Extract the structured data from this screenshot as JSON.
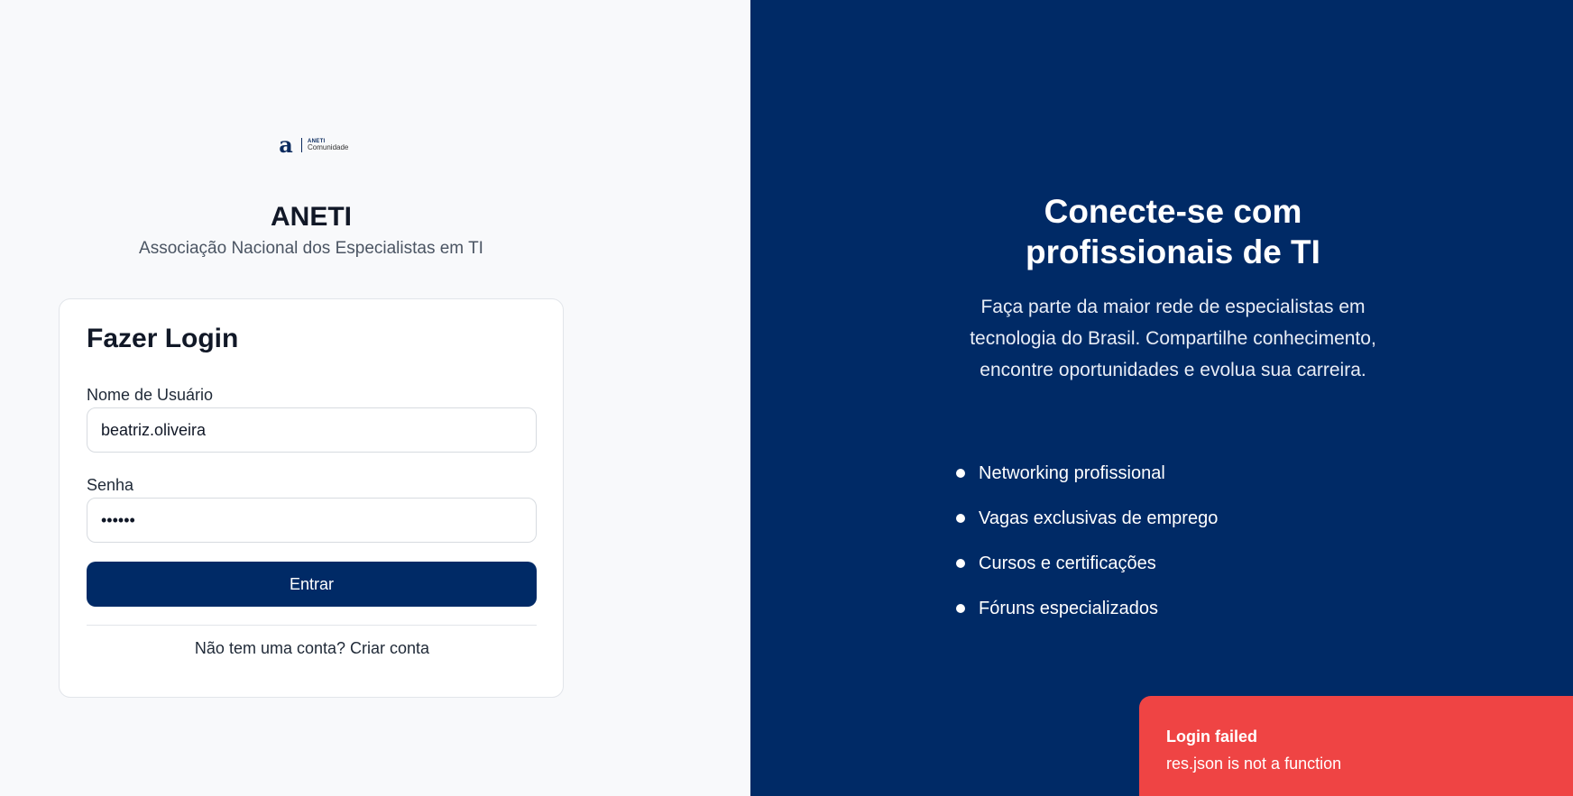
{
  "brand": {
    "logo_letter": "a",
    "logo_name": "ANETI",
    "logo_sub": "Comunidade",
    "title": "ANETI",
    "subtitle": "Associação Nacional dos Especialistas em TI"
  },
  "login": {
    "title": "Fazer Login",
    "username_label": "Nome de Usuário",
    "username_value": "beatriz.oliveira",
    "password_label": "Senha",
    "password_value": "••••••",
    "submit_label": "Entrar",
    "signup_prompt": "Não tem uma conta?",
    "signup_link": "Criar conta"
  },
  "hero": {
    "title_line1": "Conecte-se com",
    "title_line2": "profissionais de TI",
    "description": "Faça parte da maior rede de especialistas em tecnologia do Brasil. Compartilhe conhecimento, encontre oportunidades e evolua sua carreira.",
    "features": [
      "Networking profissional",
      "Vagas exclusivas de emprego",
      "Cursos e certificações",
      "Fóruns especializados"
    ]
  },
  "toast": {
    "title": "Login failed",
    "message": "res.json is not a function"
  },
  "colors": {
    "primary": "#002a66",
    "background": "#f8f9fb",
    "error": "#ef4444"
  }
}
